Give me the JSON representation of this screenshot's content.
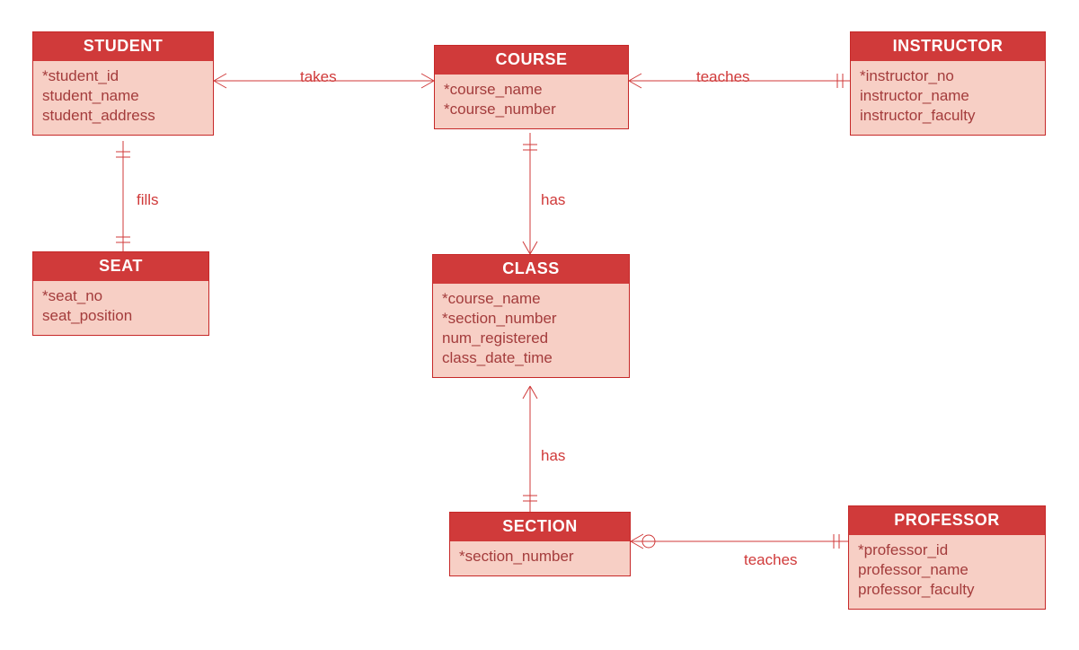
{
  "entities": {
    "student": {
      "title": "STUDENT",
      "attrs": [
        "*student_id",
        "student_name",
        "student_address"
      ]
    },
    "course": {
      "title": "COURSE",
      "attrs": [
        "*course_name",
        "*course_number"
      ]
    },
    "instructor": {
      "title": "INSTRUCTOR",
      "attrs": [
        "*instructor_no",
        "instructor_name",
        "instructor_faculty"
      ]
    },
    "seat": {
      "title": "SEAT",
      "attrs": [
        "*seat_no",
        "seat_position"
      ]
    },
    "class": {
      "title": "CLASS",
      "attrs": [
        "*course_name",
        "*section_number",
        "num_registered",
        "class_date_time"
      ]
    },
    "section": {
      "title": "SECTION",
      "attrs": [
        "*section_number"
      ]
    },
    "professor": {
      "title": "PROFESSOR",
      "attrs": [
        "*professor_id",
        "professor_name",
        "professor_faculty"
      ]
    }
  },
  "relationships": {
    "takes": "takes",
    "teaches1": "teaches",
    "fills": "fills",
    "has1": "has",
    "has2": "has",
    "teaches2": "teaches"
  },
  "colors": {
    "header_bg": "#d03a3a",
    "body_bg": "#f7cfc5",
    "text": "#a43c3c"
  }
}
